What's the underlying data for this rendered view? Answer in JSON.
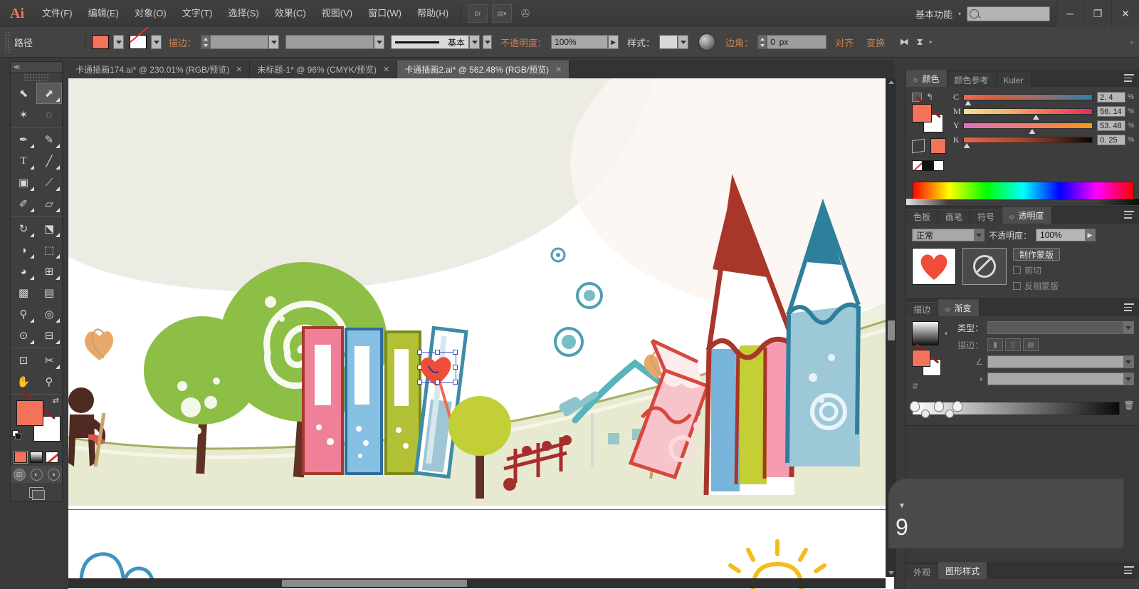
{
  "app": {
    "logo": "Ai",
    "menus": [
      "文件(F)",
      "编辑(E)",
      "对象(O)",
      "文字(T)",
      "选择(S)",
      "效果(C)",
      "视图(V)",
      "窗口(W)",
      "帮助(H)"
    ],
    "bridge_icon": "bridge-icon",
    "arrange_icon": "arrange-documents-icon",
    "stock_icon": "stock-icon",
    "workspace": "基本功能",
    "search_placeholder": "",
    "window_buttons": {
      "minimize": "─",
      "maximize": "❐",
      "close": "✕"
    }
  },
  "control_bar": {
    "object_label": "路径",
    "stroke_label": "描边：",
    "stroke_weight": "",
    "stroke_profile": "",
    "brush_label": "基本",
    "opacity_label": "不透明度：",
    "opacity_value": "100%",
    "style_label": "样式：",
    "corner_label": "边角：",
    "corner_value": "0",
    "corner_unit": "px",
    "align_label": "对齐",
    "transform_label": "变换",
    "isolate_icon": "isolate-icon",
    "select_similar_icon": "select-similar-icon"
  },
  "tabs": [
    {
      "label": "卡通插画174.ai* @ 230.01% (RGB/预览)",
      "close": "✕",
      "active": false
    },
    {
      "label": "未标题-1* @ 96% (CMYK/预览)",
      "close": "✕",
      "active": false
    },
    {
      "label": "卡通插画2.ai* @ 562.48% (RGB/预览)",
      "close": "✕",
      "active": true
    }
  ],
  "toolbar": {
    "collapse": "≪",
    "tools": [
      {
        "name": "selection-tool",
        "glyph": "⬉",
        "selected": false
      },
      {
        "name": "direct-selection-tool",
        "glyph": "⬈",
        "selected": true
      },
      {
        "name": "magic-wand-tool",
        "glyph": "✶",
        "selected": false
      },
      {
        "name": "lasso-tool",
        "glyph": "◌",
        "selected": false
      },
      {
        "name": "pen-tool",
        "glyph": "✒",
        "selected": false
      },
      {
        "name": "curvature-tool",
        "glyph": "✎",
        "selected": false
      },
      {
        "name": "type-tool",
        "glyph": "T",
        "selected": false
      },
      {
        "name": "line-segment-tool",
        "glyph": "╱",
        "selected": false
      },
      {
        "name": "rectangle-tool",
        "glyph": "▣",
        "selected": false
      },
      {
        "name": "paintbrush-tool",
        "glyph": "🖌",
        "selected": false
      },
      {
        "name": "pencil-tool",
        "glyph": "✐",
        "selected": false
      },
      {
        "name": "eraser-tool",
        "glyph": "▱",
        "selected": false
      },
      {
        "name": "rotate-tool",
        "glyph": "↻",
        "selected": false
      },
      {
        "name": "scale-tool",
        "glyph": "⬔",
        "selected": false
      },
      {
        "name": "width-tool",
        "glyph": "◑",
        "selected": false
      },
      {
        "name": "free-transform-tool",
        "glyph": "⬚",
        "selected": false
      },
      {
        "name": "shape-builder-tool",
        "glyph": "◕",
        "selected": false
      },
      {
        "name": "perspective-grid-tool",
        "glyph": "⊞",
        "selected": false
      },
      {
        "name": "mesh-tool",
        "glyph": "▩",
        "selected": false
      },
      {
        "name": "gradient-tool",
        "glyph": "▤",
        "selected": false
      },
      {
        "name": "eyedropper-tool",
        "glyph": "⚲",
        "selected": false
      },
      {
        "name": "blend-tool",
        "glyph": "◎",
        "selected": false
      },
      {
        "name": "symbol-sprayer-tool",
        "glyph": "⊙",
        "selected": false
      },
      {
        "name": "column-graph-tool",
        "glyph": "⊟",
        "selected": false
      },
      {
        "name": "artboard-tool",
        "glyph": "⊡",
        "selected": false
      },
      {
        "name": "slice-tool",
        "glyph": "✂",
        "selected": false
      },
      {
        "name": "hand-tool",
        "glyph": "✋",
        "selected": false
      },
      {
        "name": "zoom-tool",
        "glyph": "⚲",
        "selected": false
      }
    ],
    "fill_color": "#f4715a",
    "stroke_color": "#ffffff",
    "swap_icon": "swap-fill-stroke-icon",
    "default_colors_icon": "default-fill-stroke-icon",
    "mini_swatches": [
      "color-swatch",
      "gradient-swatch",
      "none-swatch"
    ],
    "draw_modes": [
      "draw-normal",
      "draw-behind",
      "draw-inside"
    ],
    "screen_mode_icon": "screen-mode-icon"
  },
  "panels": {
    "color": {
      "tabs": [
        "颜色",
        "颜色参考",
        "Kuler"
      ],
      "active_tab": "颜色",
      "menu_icon": "panel-menu-icon",
      "sliders": [
        {
          "label": "C",
          "value": "2. 4",
          "unit": "%",
          "pos": 3,
          "gradient": "linear-gradient(to right,#ef6a55,#d8603f 20%,#9a6e6a 60%,#2f7fa8)"
        },
        {
          "label": "M",
          "value": "56. 14",
          "unit": "%",
          "pos": 56,
          "gradient": "linear-gradient(to right,#f4e58a,#f2b06a 35%,#f07a5a 60%,#e8295d)"
        },
        {
          "label": "Y",
          "value": "53. 48",
          "unit": "%",
          "pos": 53,
          "gradient": "linear-gradient(to right,#e070c0,#ef7a80 40%,#f4864a 70%,#f59a18)"
        },
        {
          "label": "K",
          "value": "0. 25",
          "unit": "%",
          "pos": 2,
          "gradient": "linear-gradient(to right,#e8664a,#a8462f 45%,#5a2418 75%,#0c0604)"
        }
      ],
      "fill_color": "#f4715a",
      "spot_color": "#f4715a",
      "none_swatch": "none-swatch",
      "black_swatch": "black-swatch",
      "white_swatch": "white-swatch"
    },
    "transparency": {
      "tabs": [
        "色板",
        "画笔",
        "符号",
        "透明度"
      ],
      "active_tab": "透明度",
      "blend_mode": "正常",
      "opacity_label": "不透明度：",
      "opacity_value": "100%",
      "make_mask_button": "制作蒙版",
      "clip_label": "剪切",
      "invert_label": "反相蒙版",
      "artwork_thumb": "heart-thumbnail",
      "mask_thumb": "no-mask-icon"
    },
    "gradient": {
      "tabs": [
        "描边",
        "渐变"
      ],
      "active_tab": "渐变",
      "type_label": "类型：",
      "type_value": "",
      "stroke_label": "描边：",
      "angle_label": "∠",
      "angle_value": "",
      "aspect_label": "◑",
      "aspect_value": "",
      "delete_icon": "delete-stop-icon"
    },
    "bottom": {
      "tabs": [
        "外观",
        "图形样式"
      ],
      "active_tab": "图形样式",
      "menu_icon": "panel-menu-icon",
      "overlay_text": "9"
    }
  },
  "canvas": {
    "zoom": "562.48%",
    "artboard_edge_color": "#5b6a8a",
    "selection": {
      "color": "#4b55c8",
      "object": "heart-shape"
    },
    "palette": {
      "ground": "#e8ead0",
      "ground_line": "#a8ab5e",
      "sky_tint": "#ecece4",
      "tree_green": "#8dbe45",
      "tree_green_light": "#9ec94f",
      "trunk_brown": "#5e3326",
      "book_pink": "#f08098",
      "book_blue": "#6fb0dc",
      "book_olive": "#b2c035",
      "book_teal": "#4f9bb5",
      "pencil_red": "#b9342a",
      "pencil_blue": "#6fb0dc",
      "pencil_olive": "#c3cf34",
      "pencil_pink": "#f69bb0",
      "pencil_teal": "#2d7f9c",
      "house_teal": "#59b3bc",
      "fence_red": "#a82d2d",
      "heart_red": "#ef4c3a",
      "sun_yellow": "#f5bb1c",
      "cloud_blue": "#3e93c2"
    }
  }
}
